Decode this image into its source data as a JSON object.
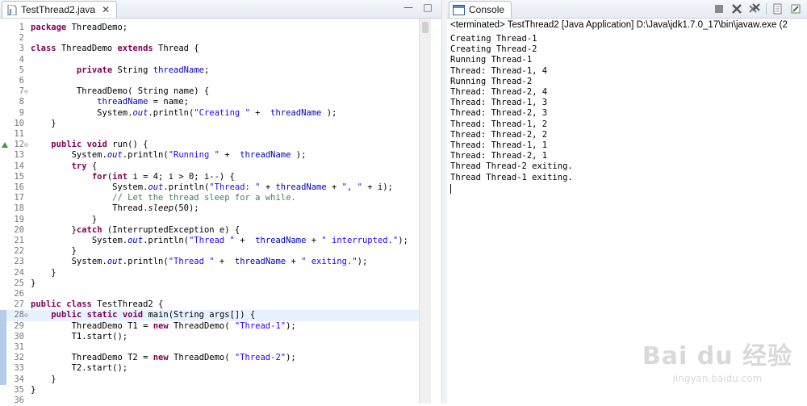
{
  "editor": {
    "tab_title": "TestThread2.java",
    "close_glyph": "✕",
    "window_buttons": [
      "—",
      "□"
    ],
    "lines": [
      {
        "n": "1",
        "html": "<span class=\"kw\">package</span> ThreadDemo;"
      },
      {
        "n": "2",
        "html": ""
      },
      {
        "n": "3",
        "html": "<span class=\"kw\">class</span> ThreadDemo <span class=\"kw\">extends</span> Thread {"
      },
      {
        "n": "4",
        "html": ""
      },
      {
        "n": "5",
        "html": "         <span class=\"kw\">private</span> String <span class=\"fld\">threadName</span>;"
      },
      {
        "n": "6",
        "html": ""
      },
      {
        "n": "7",
        "html": "         ThreadDemo( String name) {",
        "fold": "⊖"
      },
      {
        "n": "8",
        "html": "             <span class=\"fld\">threadName</span> = name;"
      },
      {
        "n": "9",
        "html": "             System.<span class=\"fld it\">out</span>.println(<span class=\"str\">\"Creating \"</span> +  <span class=\"fld\">threadName</span> );"
      },
      {
        "n": "10",
        "html": "    }"
      },
      {
        "n": "11",
        "html": ""
      },
      {
        "n": "12",
        "html": "    <span class=\"kw\">public</span> <span class=\"kw\">void</span> run() {",
        "fold": "⊖",
        "override": true
      },
      {
        "n": "13",
        "html": "        System.<span class=\"fld it\">out</span>.println(<span class=\"str\">\"Running \"</span> +  <span class=\"fld\">threadName</span> );"
      },
      {
        "n": "14",
        "html": "        <span class=\"kw\">try</span> {"
      },
      {
        "n": "15",
        "html": "            <span class=\"kw\">for</span>(<span class=\"kw\">int</span> i = 4; i &gt; 0; i--) {"
      },
      {
        "n": "16",
        "html": "                System.<span class=\"fld it\">out</span>.println(<span class=\"str\">\"Thread: \"</span> + <span class=\"fld\">threadName</span> + <span class=\"str\">\", \"</span> + i);"
      },
      {
        "n": "17",
        "html": "                <span class=\"cmt\">// Let the thread sleep for a while.</span>"
      },
      {
        "n": "18",
        "html": "                Thread.<span class=\"it\">sleep</span>(50);"
      },
      {
        "n": "19",
        "html": "            }"
      },
      {
        "n": "20",
        "html": "        }<span class=\"kw\">catch</span> (InterruptedException e) {"
      },
      {
        "n": "21",
        "html": "            System.<span class=\"fld it\">out</span>.println(<span class=\"str\">\"Thread \"</span> +  <span class=\"fld\">threadName</span> + <span class=\"str\">\" interrupted.\"</span>);"
      },
      {
        "n": "22",
        "html": "        }"
      },
      {
        "n": "23",
        "html": "        System.<span class=\"fld it\">out</span>.println(<span class=\"str\">\"Thread \"</span> +  <span class=\"fld\">threadName</span> + <span class=\"str\">\" exiting.\"</span>);"
      },
      {
        "n": "24",
        "html": "    }"
      },
      {
        "n": "25",
        "html": "}"
      },
      {
        "n": "26",
        "html": ""
      },
      {
        "n": "27",
        "html": "<span class=\"kw\">public</span> <span class=\"kw\">class</span> TestThread2 {"
      },
      {
        "n": "28",
        "html": "    <span class=\"kw\">public</span> <span class=\"kw\">static</span> <span class=\"kw\">void</span> main(String args[]) {",
        "fold": "⊖",
        "current": true
      },
      {
        "n": "29",
        "html": "        ThreadDemo T1 = <span class=\"kw\">new</span> ThreadDemo( <span class=\"str\">\"Thread-1\"</span>);"
      },
      {
        "n": "30",
        "html": "        T1.start();"
      },
      {
        "n": "31",
        "html": ""
      },
      {
        "n": "32",
        "html": "        ThreadDemo T2 = <span class=\"kw\">new</span> ThreadDemo( <span class=\"str\">\"Thread-2\"</span>);"
      },
      {
        "n": "33",
        "html": "        T2.start();"
      },
      {
        "n": "34",
        "html": "    }"
      },
      {
        "n": "35",
        "html": "}"
      },
      {
        "n": "36",
        "html": ""
      }
    ]
  },
  "console": {
    "tab_title": "Console",
    "header": "<terminated> TestThread2 [Java Application] D:\\Java\\jdk1.7.0_17\\bin\\javaw.exe (2",
    "toolbar_icons": [
      "terminate-icon",
      "remove-launch-icon",
      "remove-all-icon",
      "scroll-lock-icon",
      "pin-console-icon"
    ],
    "output": "Creating Thread-1\nCreating Thread-2\nRunning Thread-1\nThread: Thread-1, 4\nRunning Thread-2\nThread: Thread-2, 4\nThread: Thread-1, 3\nThread: Thread-2, 3\nThread: Thread-1, 2\nThread: Thread-2, 2\nThread: Thread-1, 1\nThread: Thread-2, 1\nThread Thread-2 exiting.\nThread Thread-1 exiting."
  },
  "watermark": {
    "logo": "Bai du 经验",
    "url": "jingyan.baidu.com"
  }
}
